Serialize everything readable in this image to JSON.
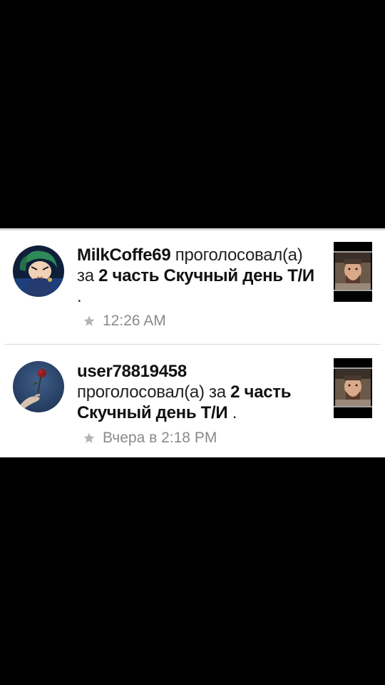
{
  "notifications": [
    {
      "username": "MilkCoffe69",
      "action_before": "проголосовал(а) за",
      "story_title": "2 часть Скучный день Т/И",
      "after": ".",
      "timestamp": "12:26 AM",
      "avatar_icon": "anime-character-avatar",
      "thumbnail_icon": "story-cover-thumbnail"
    },
    {
      "username": "user78819458",
      "action_before": "проголосовал(а) за",
      "story_title": "2 часть Скучный день Т/И",
      "after": ".",
      "timestamp": "Вчера в 2:18 PM",
      "avatar_icon": "hand-holding-rose-avatar",
      "thumbnail_icon": "story-cover-thumbnail"
    }
  ],
  "colors": {
    "background": "#000000",
    "card": "#ffffff",
    "text": "#111111",
    "muted": "#8a8a8a",
    "star": "#b5b5b5"
  }
}
